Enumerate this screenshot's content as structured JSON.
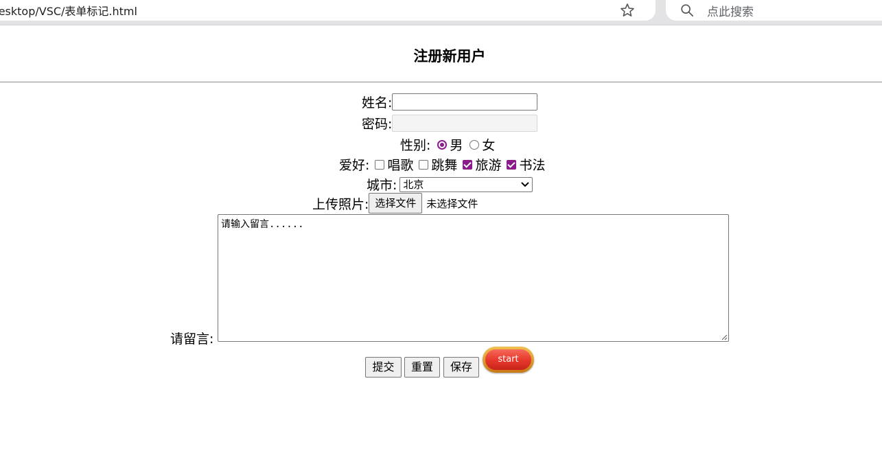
{
  "browser": {
    "address": "/Desktop/VSC/表单标记.html",
    "search_placeholder": "点此搜索"
  },
  "page": {
    "title": "注册新用户"
  },
  "form": {
    "name_label": "姓名:",
    "name_value": "",
    "password_label": "密码:",
    "password_value": "",
    "gender_label": "性别:",
    "gender_options": [
      {
        "label": "男",
        "checked": true
      },
      {
        "label": "女",
        "checked": false
      }
    ],
    "hobby_label": "爱好:",
    "hobbies": [
      {
        "label": "唱歌",
        "checked": false
      },
      {
        "label": "跳舞",
        "checked": false
      },
      {
        "label": "旅游",
        "checked": true
      },
      {
        "label": "书法",
        "checked": true
      }
    ],
    "city_label": "城市:",
    "city_selected": "北京",
    "photo_label": "上传照片:",
    "file_button": "选择文件",
    "file_status": "未选择文件",
    "message_label": "请留言:",
    "message_text": "请输入留言......",
    "buttons": {
      "submit": "提交",
      "reset": "重置",
      "save": "保存",
      "start": "start"
    }
  },
  "colors": {
    "accent": "#8b1a8b",
    "chrome": "#e3e3e6"
  }
}
